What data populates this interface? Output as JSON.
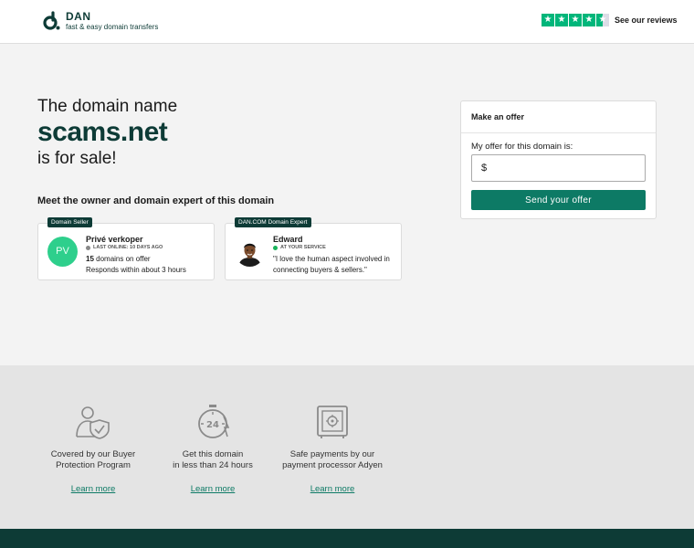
{
  "header": {
    "brand": "DAN",
    "tagline": "fast & easy domain transfers",
    "reviews_label": "See our reviews"
  },
  "hero": {
    "line1": "The domain name",
    "domain": "scams.net",
    "line3": "is for sale!",
    "meet_heading": "Meet the owner and domain expert of this domain"
  },
  "seller": {
    "badge": "Domain Seller",
    "initials": "PV",
    "name": "Privé verkoper",
    "status": "LAST ONLINE: 10 DAYS AGO",
    "count": "15",
    "count_suffix": " domains on offer",
    "response": "Responds within about 3 hours"
  },
  "expert": {
    "badge": "DAN.COM Domain Expert",
    "name": "Edward",
    "status": "AT YOUR SERVICE",
    "quote1": "\"I love the human aspect involved in",
    "quote2": "connecting buyers & sellers.\""
  },
  "offer": {
    "title": "Make an offer",
    "label": "My offer for this domain is:",
    "currency": "$",
    "input_value": "",
    "button": "Send your offer"
  },
  "features": [
    {
      "icon": "protection-icon",
      "line1": "Covered by our Buyer",
      "line2": "Protection Program",
      "link": "Learn more"
    },
    {
      "icon": "clock-24-icon",
      "line1": "Get this domain",
      "line2": "in less than 24 hours",
      "link": "Learn more"
    },
    {
      "icon": "safe-icon",
      "line1": "Safe payments by our",
      "line2": "payment processor Adyen",
      "link": "Learn more"
    }
  ],
  "colors": {
    "brand": "#0d3b36",
    "accent": "#0d7a65",
    "trustpilot": "#00b67a",
    "avatar": "#2ecf8c"
  }
}
